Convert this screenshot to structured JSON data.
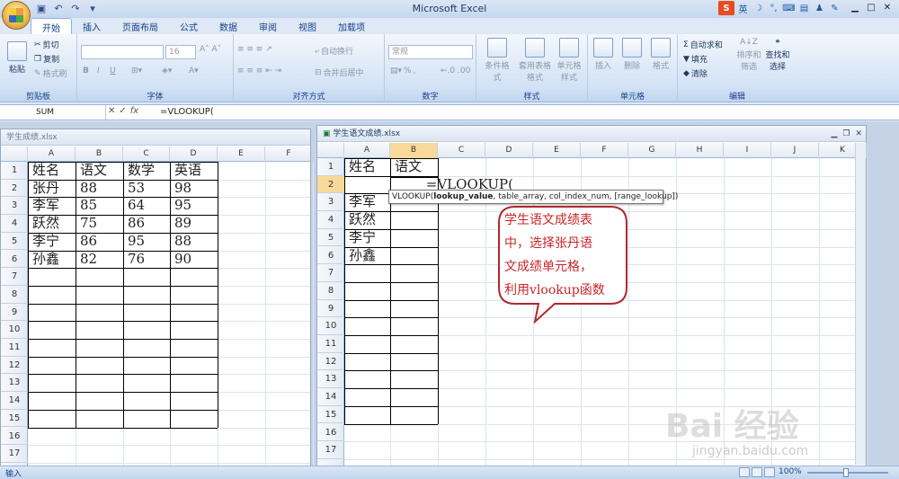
{
  "app": {
    "title": "Microsoft Excel"
  },
  "qat": {
    "save_icon": "save-icon",
    "undo_icon": "undo-icon",
    "redo_icon": "redo-icon"
  },
  "tray": {
    "ime_label": "英",
    "items": [
      "sogou-icon",
      "moon-icon",
      "punct-icon",
      "keyboard-icon",
      "skin-icon",
      "user-icon",
      "tools-icon"
    ]
  },
  "ribbon": {
    "tabs": [
      "开始",
      "插入",
      "页面布局",
      "公式",
      "数据",
      "审阅",
      "视图",
      "加载项"
    ],
    "active_tab": 0,
    "clipboard": {
      "paste": "粘贴",
      "cut": "剪切",
      "copy": "复制",
      "format_painter": "格式刷",
      "label": "剪贴板"
    },
    "font": {
      "size": "16",
      "label": "字体"
    },
    "align": {
      "wrap": "自动换行",
      "merge": "合并后居中",
      "label": "对齐方式"
    },
    "number": {
      "format": "常规",
      "percent": "%",
      "label": "数字"
    },
    "styles": {
      "cond": "条件格式",
      "table": "套用表格格式",
      "cell": "单元格样式",
      "label": "样式"
    },
    "cells": {
      "insert": "插入",
      "delete": "删除",
      "format": "格式",
      "label": "单元格"
    },
    "editing": {
      "autosum": "自动求和",
      "fill": "填充",
      "clear": "清除",
      "sort": "排序和筛选",
      "find": "查找和选择",
      "label": "编辑"
    }
  },
  "formula_bar": {
    "name_box": "SUM",
    "formula": "=VLOOKUP("
  },
  "left_window": {
    "title": "学生成绩.xlsx",
    "columns": [
      "A",
      "B",
      "C",
      "D",
      "E",
      "F"
    ],
    "rows": [
      "1",
      "2",
      "3",
      "4",
      "5",
      "6",
      "7",
      "8",
      "9",
      "10",
      "11",
      "12",
      "13",
      "14",
      "15",
      "16",
      "17"
    ],
    "data": [
      [
        "姓名",
        "语文",
        "数学",
        "英语"
      ],
      [
        "张丹",
        "88",
        "53",
        "98"
      ],
      [
        "李军",
        "85",
        "64",
        "95"
      ],
      [
        "跃然",
        "75",
        "86",
        "89"
      ],
      [
        "李宁",
        "86",
        "95",
        "88"
      ],
      [
        "孙鑫",
        "82",
        "76",
        "90"
      ]
    ]
  },
  "right_window": {
    "title": "学生语文成绩.xlsx",
    "columns": [
      "A",
      "B",
      "C",
      "D",
      "E",
      "F",
      "G",
      "H",
      "I",
      "J",
      "K"
    ],
    "rows": [
      "1",
      "2",
      "3",
      "4",
      "5",
      "6",
      "7",
      "8",
      "9",
      "10",
      "11",
      "12",
      "13",
      "14",
      "15",
      "16",
      "17"
    ],
    "data": [
      [
        "姓名",
        "语文"
      ],
      [
        "",
        "=VLOOKUP("
      ],
      [
        "李军",
        ""
      ],
      [
        "跃然",
        ""
      ],
      [
        "李宁",
        ""
      ],
      [
        "孙鑫",
        ""
      ]
    ],
    "tooltip": {
      "fn": "VLOOKUP(",
      "arg1": "lookup_value",
      "rest": ", table_array, col_index_num, [range_lookup])"
    }
  },
  "callout": {
    "lines": [
      "学生语文成绩表",
      "中，选择张丹语",
      "文成绩单元格，",
      "利用vlookup函数"
    ],
    "color": "#c8252a"
  },
  "status": {
    "mode": "输入",
    "zoom": "100%"
  },
  "watermark": {
    "logo": "Bai 经验",
    "url": "jingyan.baidu.com"
  }
}
